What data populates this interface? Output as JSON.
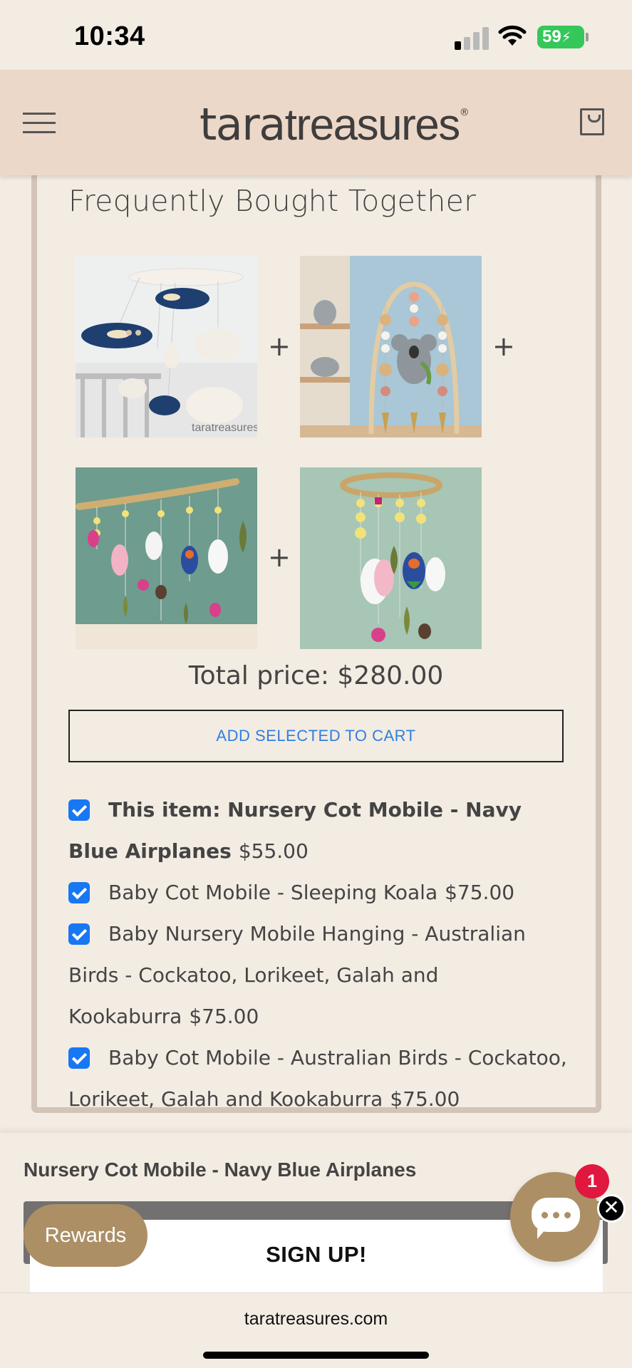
{
  "status_bar": {
    "time": "10:34",
    "battery": "59"
  },
  "header": {
    "logo_bold": "tara",
    "logo_light": "treasures",
    "logo_mark": "®"
  },
  "fbt": {
    "title": "Frequently Bought Together",
    "total_label": "Total price: $280.00",
    "add_button": "ADD SELECTED TO CART",
    "items": [
      {
        "prefix": "This item: ",
        "name": "Nursery Cot Mobile - Navy Blue Airplanes",
        "price": "$55.00",
        "checked": true
      },
      {
        "prefix": "",
        "name": "Baby Cot Mobile - Sleeping Koala",
        "price": "$75.00",
        "checked": true
      },
      {
        "prefix": "",
        "name": "Baby Nursery Mobile Hanging - Australian Birds - Cockatoo, Lorikeet, Galah and Kookaburra",
        "price": "$75.00",
        "checked": true
      },
      {
        "prefix": "",
        "name": "Baby Cot Mobile - Australian Birds - Cockatoo, Lorikeet, Galah and Kookaburra",
        "price": "$75.00",
        "checked": true
      }
    ],
    "image_watermark": "taratreasures"
  },
  "sticky": {
    "product_title": "Nursery Cot Mobile - Navy Blue Airplanes",
    "signup": "SIGN UP!",
    "rewards": "Rewards",
    "chat_badge": "1",
    "close": "✕"
  },
  "browser": {
    "url": "taratreasures.com"
  },
  "colors": {
    "header_bg": "#ecd8c9",
    "page_bg": "#f3ece3",
    "accent": "#ad8f66",
    "checkbox": "#1877f2",
    "link_blue": "#2f7fe0"
  }
}
